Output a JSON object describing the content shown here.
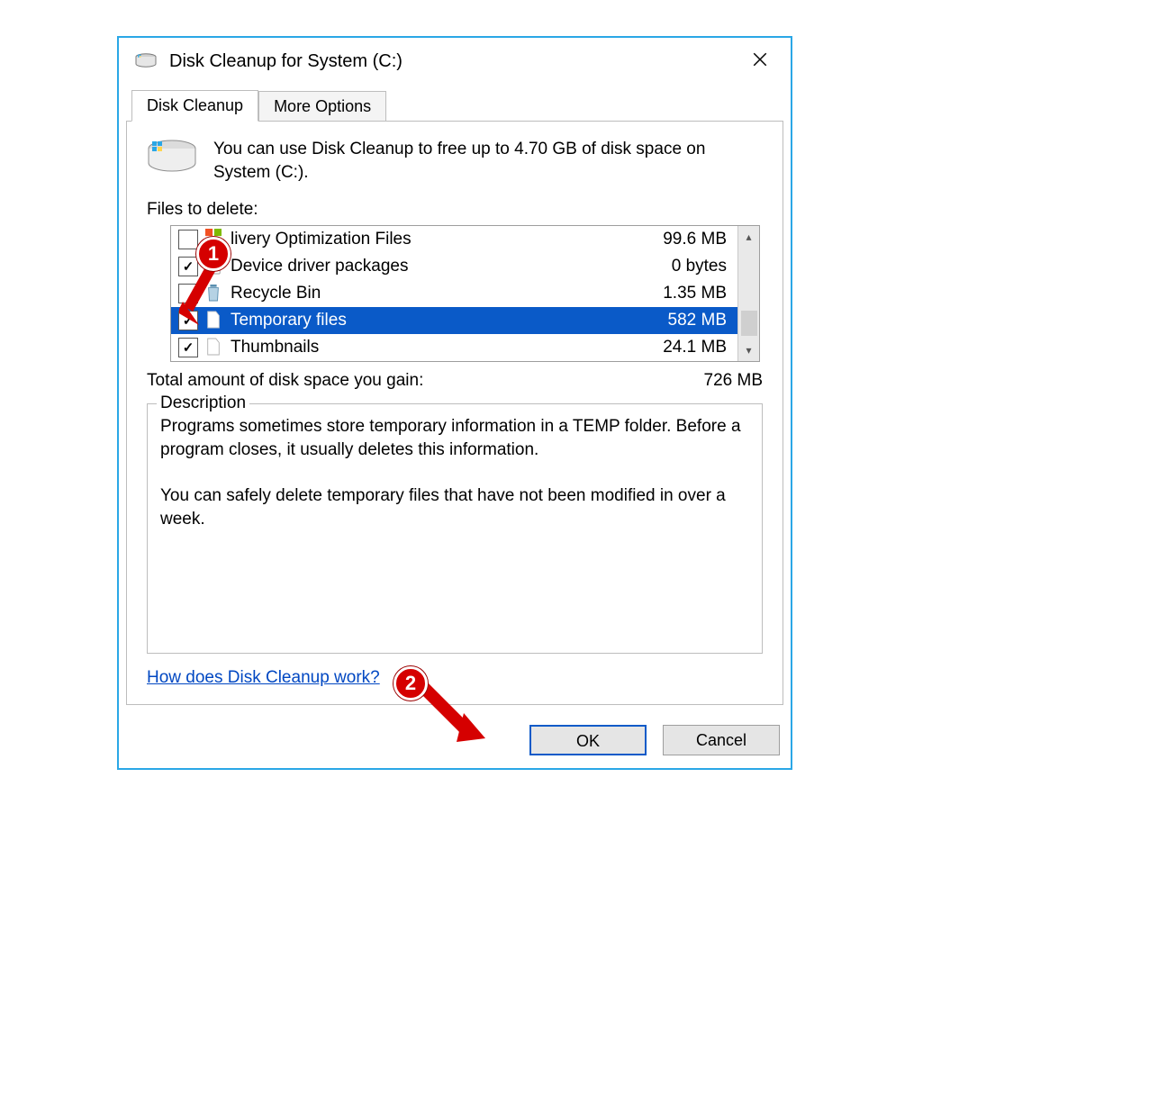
{
  "window": {
    "title": "Disk Cleanup for System (C:)"
  },
  "tabs": {
    "cleanup": "Disk Cleanup",
    "more": "More Options"
  },
  "intro": "You can use Disk Cleanup to free up to 4.70 GB of disk space on System (C:).",
  "files_label": "Files to delete:",
  "files": [
    {
      "name": "livery Optimization Files",
      "size": "99.6 MB",
      "checked": false,
      "icon": "win"
    },
    {
      "name": "Device driver packages",
      "size": "0 bytes",
      "checked": true,
      "icon": "pkg"
    },
    {
      "name": "Recycle Bin",
      "size": "1.35 MB",
      "checked": false,
      "icon": "bin"
    },
    {
      "name": "Temporary files",
      "size": "582 MB",
      "checked": true,
      "icon": "doc",
      "selected": true
    },
    {
      "name": "Thumbnails",
      "size": "24.1 MB",
      "checked": true,
      "icon": "doc"
    }
  ],
  "total": {
    "label": "Total amount of disk space you gain:",
    "value": "726 MB"
  },
  "description": {
    "legend": "Description",
    "body": "Programs sometimes store temporary information in a TEMP folder. Before a program closes, it usually deletes this information.\n\nYou can safely delete temporary files that have not been modified in over a week."
  },
  "help_link": "How does Disk Cleanup work?",
  "buttons": {
    "ok": "OK",
    "cancel": "Cancel"
  },
  "annotations": {
    "one": "1",
    "two": "2"
  }
}
